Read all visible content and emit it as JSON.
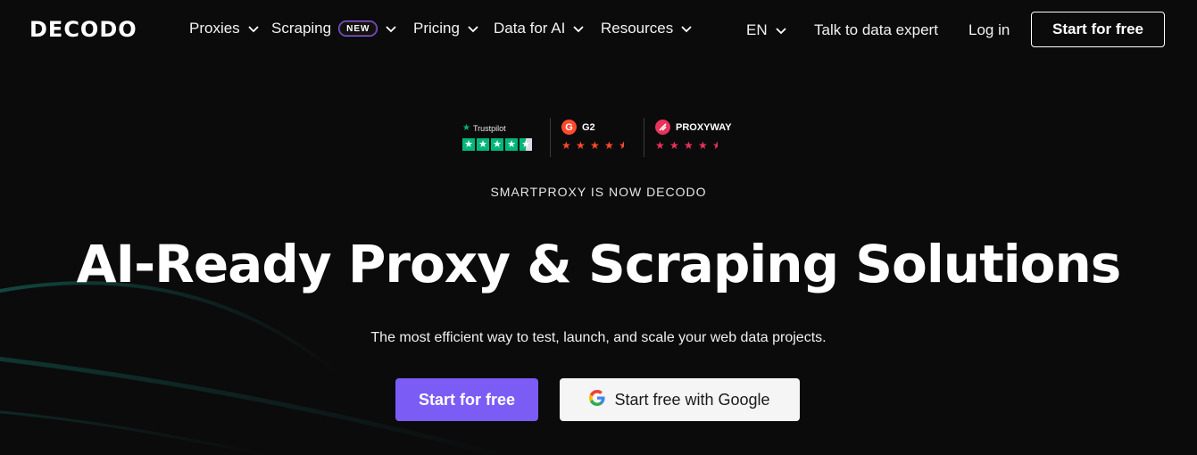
{
  "nav": {
    "logo_text": "DECODO",
    "items": [
      {
        "label": "Proxies"
      },
      {
        "label": "Scraping",
        "badge": "NEW"
      },
      {
        "label": "Pricing"
      },
      {
        "label": "Data for AI"
      },
      {
        "label": "Resources"
      }
    ],
    "language": "EN",
    "talk_link": "Talk to data expert",
    "login_link": "Log in",
    "cta": "Start for free"
  },
  "ratings": {
    "trustpilot": {
      "label": "Trustpilot",
      "stars": 4.5
    },
    "g2": {
      "label": "G2",
      "stars": 4.5
    },
    "proxyway": {
      "label": "PROXYWAY",
      "stars": 4.5
    }
  },
  "hero": {
    "eyebrow": "SMARTPROXY IS NOW DECODO",
    "headline": "AI-Ready Proxy & Scraping Solutions",
    "subtext": "The most efficient way to test, launch, and scale your web data projects.",
    "primary_cta": "Start for free",
    "google_cta": "Start free with Google"
  },
  "colors": {
    "background": "#0b0b0c",
    "primary_button": "#7b5cf5",
    "trustpilot_green": "#00b67a",
    "g2_red": "#ff492c",
    "proxyway_pink": "#e8335a"
  },
  "icons": [
    "chevron-down-icon",
    "trustpilot-star-icon",
    "g2-logo-icon",
    "proxyway-logo-icon",
    "google-g-icon",
    "star-icon"
  ]
}
